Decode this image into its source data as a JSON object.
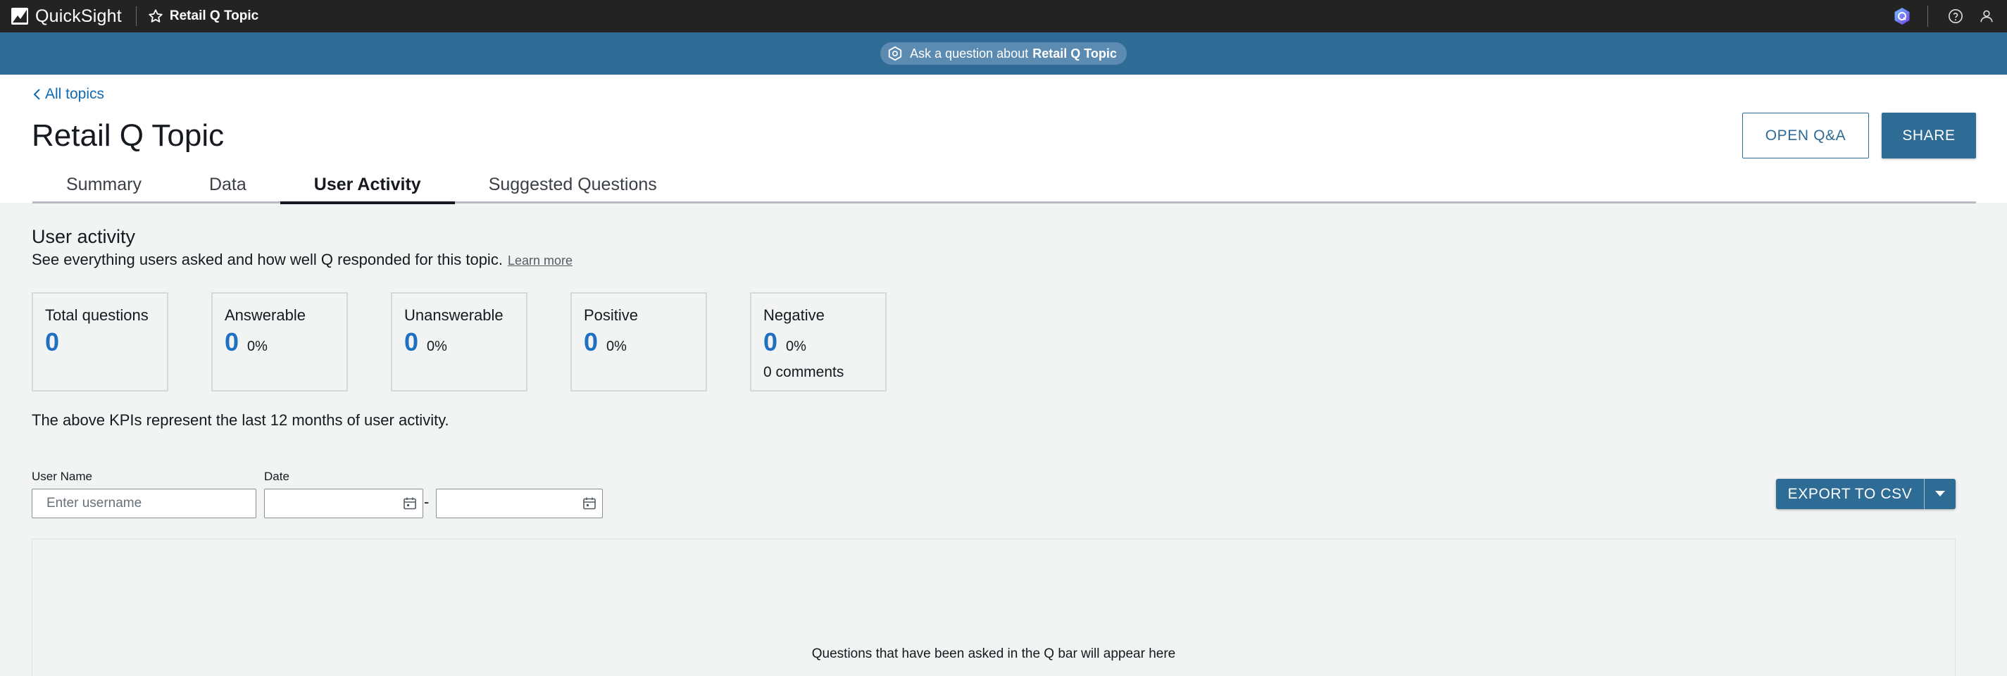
{
  "app": {
    "brand": "QuickSight",
    "topic_title": "Retail Q Topic"
  },
  "askbar": {
    "prefix": "Ask a question about",
    "topic": "Retail Q Topic"
  },
  "header": {
    "back_label": "All topics",
    "title": "Retail Q Topic",
    "open_qa_label": "OPEN Q&A",
    "share_label": "SHARE",
    "tabs": [
      {
        "label": "Summary",
        "active": false
      },
      {
        "label": "Data",
        "active": false
      },
      {
        "label": "User Activity",
        "active": true
      },
      {
        "label": "Suggested Questions",
        "active": false
      }
    ]
  },
  "activity": {
    "title": "User activity",
    "description": "See everything users asked and how well Q responded for this topic.",
    "learn_more": "Learn more",
    "kpis": [
      {
        "label": "Total questions",
        "value": "0"
      },
      {
        "label": "Answerable",
        "value": "0",
        "percent": "0%"
      },
      {
        "label": "Unanswerable",
        "value": "0",
        "percent": "0%"
      },
      {
        "label": "Positive",
        "value": "0",
        "percent": "0%"
      },
      {
        "label": "Negative",
        "value": "0",
        "percent": "0%",
        "extra": "0 comments"
      }
    ],
    "kpi_note": "The above KPIs represent the last 12 months of user activity."
  },
  "filters": {
    "user_name_label": "User Name",
    "user_name_placeholder": "Enter username",
    "user_name_value": "",
    "date_label": "Date",
    "date_start": "",
    "date_end": "",
    "date_separator": "-"
  },
  "export": {
    "label": "EXPORT TO CSV"
  },
  "table": {
    "empty_message": "Questions that have been asked in the Q bar will appear here"
  },
  "colors": {
    "accent": "#2e6b95",
    "kpi_value": "#1f70c1",
    "topbar": "#232323",
    "link": "#0f6ab3"
  }
}
